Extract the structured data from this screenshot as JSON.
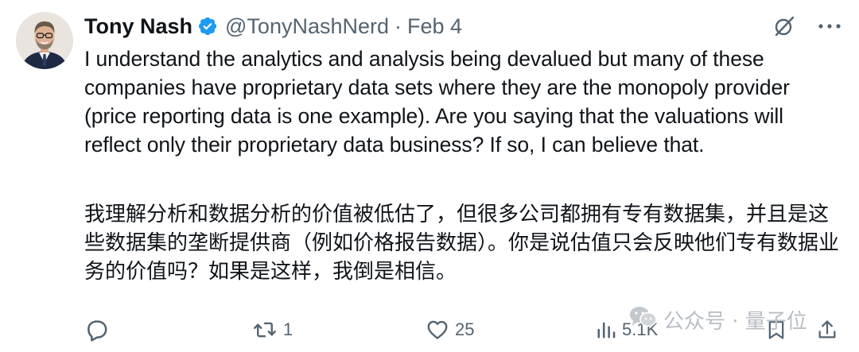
{
  "author": {
    "name": "Tony Nash",
    "handle": "@TonyNashNerd",
    "separator": "·",
    "date": "Feb 4",
    "verified": true
  },
  "tweet": {
    "text_en": "I understand the analytics and analysis being devalued but many of these companies have proprietary data sets where they are the monopoly provider (price reporting data is one example). Are you saying that the valuations will reflect only their proprietary data business? If so, I can believe that.",
    "text_zh": "我理解分析和数据分析的价值被低估了，但很多公司都拥有专有数据集，并且是这些数据集的垄断提供商（例如价格报告数据）。你是说估值只会反映他们专有数据业务的价值吗？如果是这样，我倒是相信。"
  },
  "actions": {
    "reply": {
      "icon": "reply-icon",
      "count": ""
    },
    "retweet": {
      "icon": "retweet-icon",
      "count": "1"
    },
    "like": {
      "icon": "heart-icon",
      "count": "25"
    },
    "views": {
      "icon": "views-icon",
      "count": "5.1K"
    },
    "bookmark": {
      "icon": "bookmark-icon"
    },
    "share": {
      "icon": "share-icon"
    }
  },
  "top_icons": [
    "grok-icon",
    "more-icon"
  ],
  "watermark": {
    "text": "公众号 · 量子位"
  },
  "colors": {
    "text": "#0f1419",
    "secondary": "#536471",
    "verified": "#1d9bf0",
    "watermark": "#b8bec4"
  }
}
